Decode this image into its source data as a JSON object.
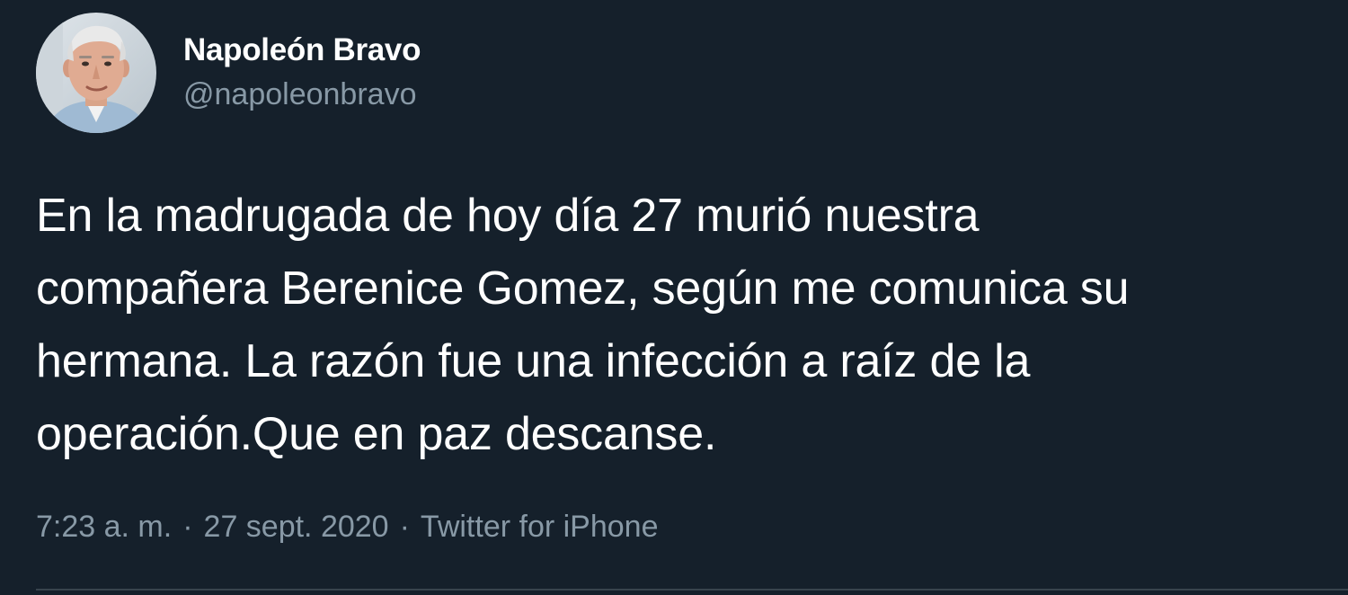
{
  "tweet": {
    "author": {
      "display_name": "Napoleón Bravo",
      "handle": "@napoleonbravo",
      "avatar_icon": "profile-photo"
    },
    "text": "En la madrugada de hoy día 27 murió nuestra\ncompañera Berenice Gomez, según me comunica su\nhermana. La razón fue una infección a raíz de la\noperación.Que en paz descanse.",
    "time": "7:23 a. m.",
    "separator": "·",
    "date": "27 sept. 2020",
    "source": "Twitter for iPhone"
  },
  "colors": {
    "background": "#15202b",
    "primary_text": "#ffffff",
    "secondary_text": "#8899a6",
    "divider": "#38444d"
  }
}
